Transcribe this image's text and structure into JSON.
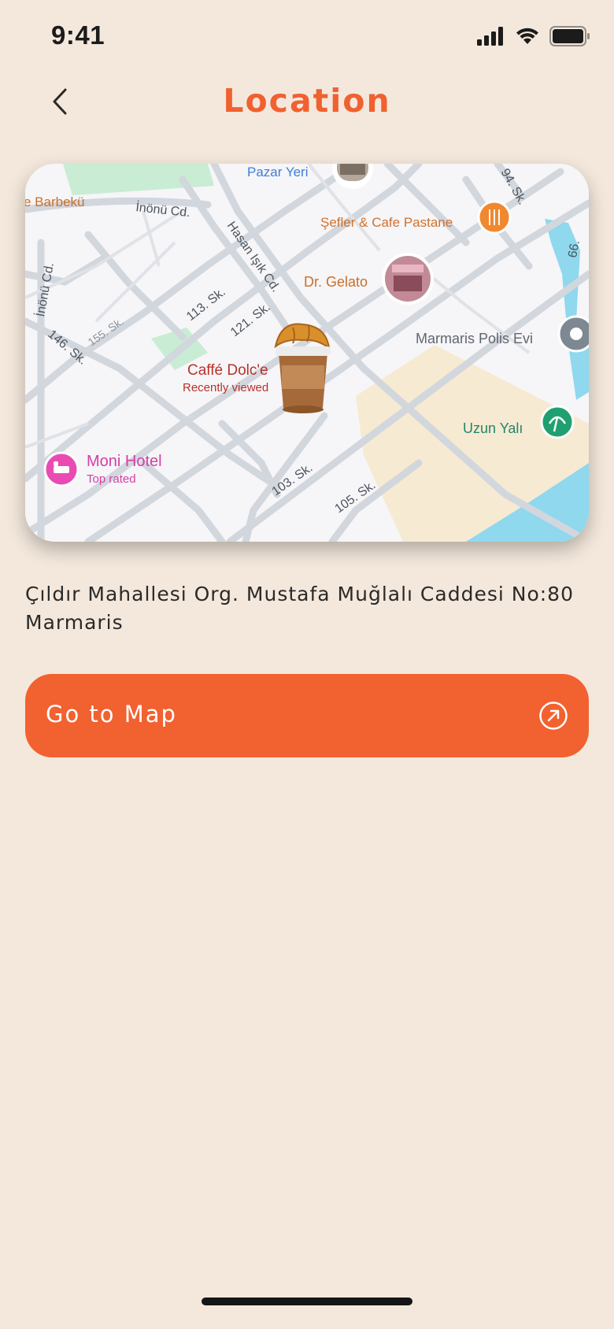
{
  "status_bar": {
    "time": "9:41"
  },
  "header": {
    "title": "Location"
  },
  "map": {
    "labels": {
      "barbeku": "e Barbekü",
      "inonu_cd": "İnönü Cd.",
      "inonu_cd_vertical": "İnönü Cd.",
      "pazar_yeri": "Pazar Yeri",
      "sefler": "Şefler & Cafe Pastane",
      "hasan_isik": "Hasan Işık Cd.",
      "dr_gelato": "Dr. Gelato",
      "sk_113": "113. Sk.",
      "sk_121": "121. Sk.",
      "sk_155": "155. Sk.",
      "sk_146": "146. Sk.",
      "sk_94": "94. Sk.",
      "sk_66": "66.",
      "marmaris_polis": "Marmaris Polis Evi",
      "caffe_dolce": "Caffé Dolc'e",
      "recently_viewed": "Recently viewed",
      "uzun_yali": "Uzun Yalı",
      "moni_hotel": "Moni Hotel",
      "top_rated": "Top rated",
      "sk_103": "103. Sk.",
      "sk_105": "105. Sk."
    }
  },
  "address": {
    "line1": "Çıldır Mahallesi Org. Mustafa Muğlalı Caddesi No:80",
    "line2": "Marmaris"
  },
  "go_to_map": {
    "label": "Go to Map"
  },
  "colors": {
    "background": "#f4e8dc",
    "accent": "#f26130",
    "title": "#f0612f"
  }
}
